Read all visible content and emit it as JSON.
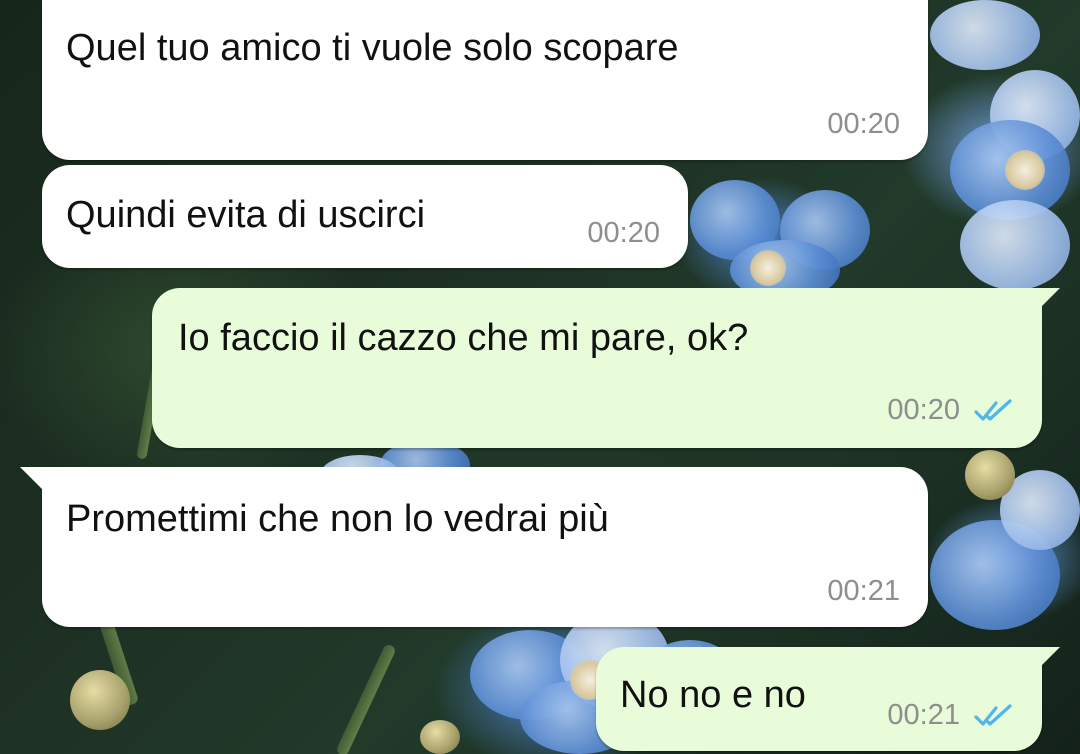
{
  "conversation": {
    "messages": [
      {
        "direction": "incoming",
        "text": "Quel tuo amico ti vuole solo scopare",
        "time": "00:20"
      },
      {
        "direction": "incoming",
        "text": "Quindi evita di uscirci",
        "time": "00:20"
      },
      {
        "direction": "outgoing",
        "text": "Io faccio il cazzo che mi pare, ok?",
        "time": "00:20",
        "status": "read"
      },
      {
        "direction": "incoming",
        "text": "Promettimi che non lo vedrai più",
        "time": "00:21"
      },
      {
        "direction": "outgoing",
        "text": "No no e no",
        "time": "00:21",
        "status": "read"
      }
    ]
  },
  "colors": {
    "incoming_bubble": "#ffffff",
    "outgoing_bubble": "#e9fcd9",
    "read_ticks": "#4fb6ec",
    "timestamp": "#8e8e8e"
  },
  "icons": {
    "read_receipt": "double-check-icon",
    "wallpaper": "forget-me-not-flowers"
  }
}
